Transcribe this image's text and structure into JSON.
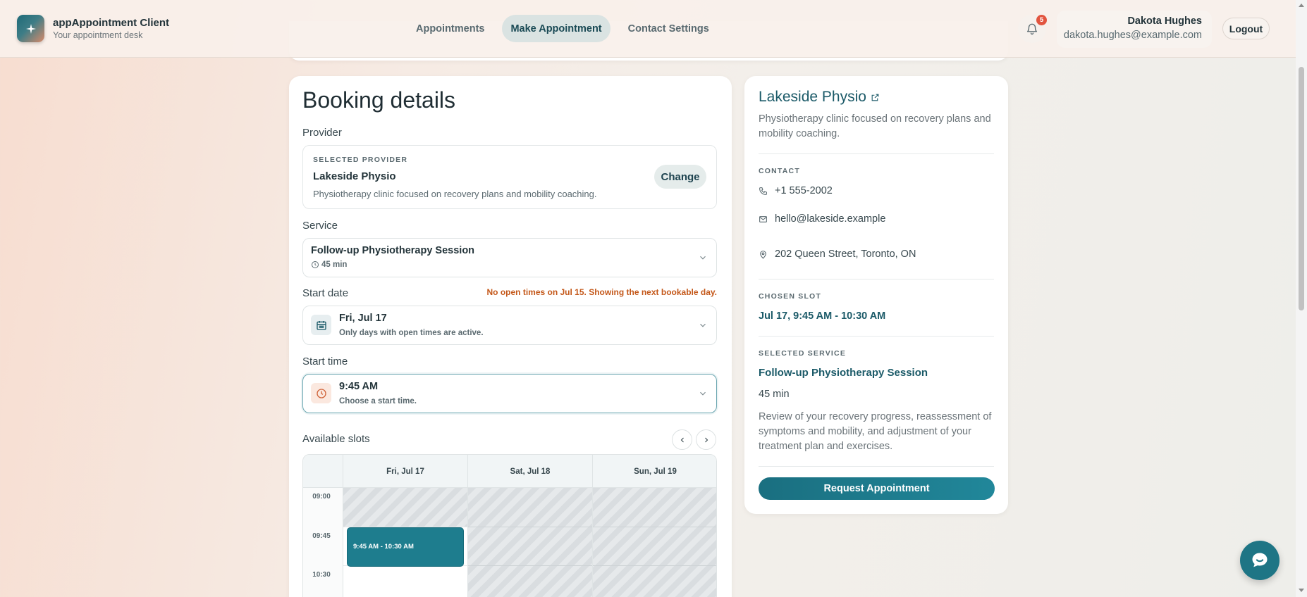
{
  "app": {
    "title": "appAppointment Client",
    "subtitle": "Your appointment desk"
  },
  "nav": {
    "tabs": [
      {
        "label": "Appointments",
        "active": false
      },
      {
        "label": "Make Appointment",
        "active": true
      },
      {
        "label": "Contact Settings",
        "active": false
      }
    ]
  },
  "notifications": {
    "count": "5",
    "icon": "bell-icon"
  },
  "user": {
    "name": "Dakota Hughes",
    "email": "dakota.hughes@example.com"
  },
  "logout_label": "Logout",
  "booking": {
    "title": "Booking details",
    "provider_label": "Provider",
    "selected_provider_label": "SELECTED PROVIDER",
    "provider_name": "Lakeside Physio",
    "provider_desc": "Physiotherapy clinic focused on recovery plans and mobility coaching.",
    "change_label": "Change",
    "service_label": "Service",
    "service_value": "Follow-up Physiotherapy Session",
    "service_duration": "45 min",
    "start_date_label": "Start date",
    "date_warning": "No open times on Jul 15. Showing the next bookable day.",
    "start_date_value": "Fri, Jul 17",
    "start_date_hint": "Only days with open times are active.",
    "start_time_label": "Start time",
    "start_time_value": "9:45 AM",
    "start_time_hint": "Choose a start time.",
    "slots_label": "Available slots"
  },
  "calendar": {
    "days": [
      "Fri, Jul 17",
      "Sat, Jul 18",
      "Sun, Jul 19"
    ],
    "times": [
      "09:00",
      "09:45",
      "10:30"
    ],
    "selected_slot": "9:45 AM - 10:30 AM"
  },
  "detail": {
    "name": "Lakeside Physio",
    "desc": "Physiotherapy clinic focused on recovery plans and mobility coaching.",
    "contact_label": "CONTACT",
    "phone": "+1 555-2002",
    "email": "hello@lakeside.example",
    "address": "202 Queen Street, Toronto, ON",
    "chosen_slot_label": "CHOSEN SLOT",
    "chosen_slot": "Jul 17, 9:45 AM - 10:30 AM",
    "selected_service_label": "SELECTED SERVICE",
    "service_name": "Follow-up Physiotherapy Session",
    "service_duration": "45 min",
    "service_desc": "Review of your recovery progress, reassessment of symptoms and mobility, and adjustment of your treatment plan and exercises.",
    "request_label": "Request Appointment"
  },
  "colors": {
    "accent": "#1e7d8e",
    "warning": "#c4581a",
    "badge": "#e2543f"
  }
}
